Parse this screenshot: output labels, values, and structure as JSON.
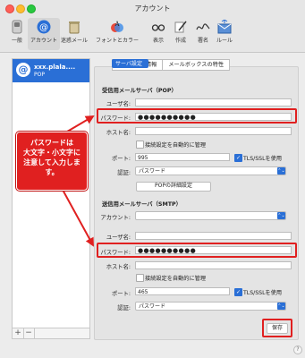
{
  "window": {
    "title": "アカウント"
  },
  "toolbar": {
    "items": [
      {
        "label": "一般"
      },
      {
        "label": "アカウント"
      },
      {
        "label": "迷惑メール"
      },
      {
        "label": "フォントとカラー"
      },
      {
        "label": "表示"
      },
      {
        "label": "作成"
      },
      {
        "label": "署名"
      },
      {
        "label": "ルール"
      }
    ]
  },
  "sidebar": {
    "account_name": "xxx.plala....",
    "account_type": "POP",
    "icon_glyph": "@",
    "add_label": "+",
    "remove_label": "−"
  },
  "tabs": [
    {
      "label": "アカウント情報",
      "selected": false
    },
    {
      "label": "メールボックスの特性",
      "selected": false
    },
    {
      "label": "サーバ設定",
      "selected": true
    }
  ],
  "incoming": {
    "section_title": "受信用メールサーバ（POP）",
    "username_label": "ユーザ名:",
    "username_value": "",
    "password_label": "パスワード:",
    "password_value": "●●●●●●●●●●",
    "host_label": "ホスト名:",
    "host_value": "",
    "auto_manage_label": "接続設定を自動的に管理",
    "port_label": "ポート:",
    "port_value": "995",
    "tls_label": "TLS/SSLを使用",
    "auth_label": "認証:",
    "auth_value": "パスワード",
    "pop_detail_button": "POPの詳細設定"
  },
  "outgoing": {
    "section_title": "送信用メールサーバ（SMTP）",
    "account_label": "アカウント:",
    "account_value": "",
    "username_label": "ユーザ名:",
    "username_value": "",
    "password_label": "パスワード:",
    "password_value": "●●●●●●●●●●",
    "host_label": "ホスト名:",
    "host_value": "",
    "auto_manage_label": "接続設定を自動的に管理",
    "port_label": "ポート:",
    "port_value": "465",
    "tls_label": "TLS/SSLを使用",
    "auth_label": "認証:",
    "auth_value": "パスワード"
  },
  "save_button": "保存",
  "callout": {
    "line1": "パスワードは",
    "line2": "大文字・小文字に",
    "line3": "注意して入力しま",
    "line4": "す。"
  },
  "help_glyph": "?",
  "colors": {
    "accent": "#2a6fd6",
    "annotation": "#e02020"
  }
}
